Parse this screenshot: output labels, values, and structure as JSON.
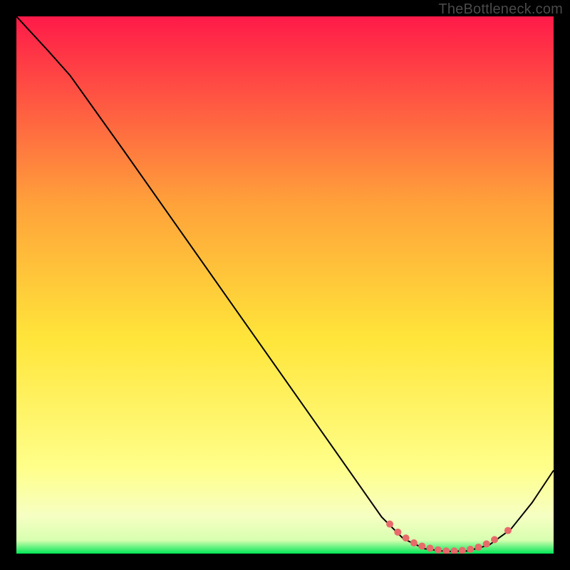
{
  "watermark": "TheBottleneck.com",
  "chart_data": {
    "type": "line",
    "title": "",
    "xlabel": "",
    "ylabel": "",
    "xlim": [
      0,
      100
    ],
    "ylim": [
      0,
      100
    ],
    "grid": false,
    "background_gradient": {
      "top": "#ff1a49",
      "mid_upper": "#ffa23a",
      "mid": "#ffe53a",
      "mid_lower": "#ffff8a",
      "band": "#f6ffc2",
      "bottom": "#00e756"
    },
    "series": [
      {
        "name": "curve",
        "color": "#000000",
        "stroke_width": 2,
        "points": [
          {
            "x": 0.0,
            "y": 100.0
          },
          {
            "x": 6.0,
            "y": 93.5
          },
          {
            "x": 10.0,
            "y": 89.0
          },
          {
            "x": 20.0,
            "y": 75.0
          },
          {
            "x": 30.0,
            "y": 60.8
          },
          {
            "x": 40.0,
            "y": 46.6
          },
          {
            "x": 50.0,
            "y": 32.4
          },
          {
            "x": 60.0,
            "y": 18.2
          },
          {
            "x": 68.0,
            "y": 6.8
          },
          {
            "x": 72.0,
            "y": 2.8
          },
          {
            "x": 76.0,
            "y": 0.9
          },
          {
            "x": 80.0,
            "y": 0.4
          },
          {
            "x": 84.0,
            "y": 0.5
          },
          {
            "x": 88.0,
            "y": 1.6
          },
          {
            "x": 92.0,
            "y": 4.5
          },
          {
            "x": 96.0,
            "y": 9.5
          },
          {
            "x": 100.0,
            "y": 15.5
          }
        ]
      }
    ],
    "markers": {
      "color": "#e86a6a",
      "radius": 5,
      "points": [
        {
          "x": 69.5,
          "y": 5.5
        },
        {
          "x": 71.0,
          "y": 4.0
        },
        {
          "x": 72.5,
          "y": 2.9
        },
        {
          "x": 74.0,
          "y": 2.0
        },
        {
          "x": 75.5,
          "y": 1.4
        },
        {
          "x": 77.0,
          "y": 1.0
        },
        {
          "x": 78.5,
          "y": 0.7
        },
        {
          "x": 80.0,
          "y": 0.5
        },
        {
          "x": 81.5,
          "y": 0.5
        },
        {
          "x": 83.0,
          "y": 0.6
        },
        {
          "x": 84.5,
          "y": 0.8
        },
        {
          "x": 86.0,
          "y": 1.2
        },
        {
          "x": 87.5,
          "y": 1.8
        },
        {
          "x": 89.0,
          "y": 2.6
        },
        {
          "x": 91.5,
          "y": 4.3
        }
      ]
    }
  }
}
